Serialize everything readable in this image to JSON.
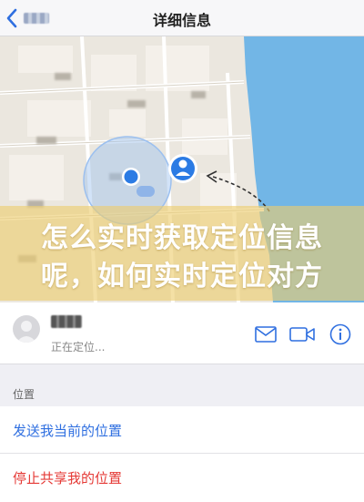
{
  "nav": {
    "title": "详细信息",
    "back_icon": "chevron-left-icon"
  },
  "overlay": {
    "line1": "怎么实时获取定位信息",
    "line2": "呢，如何实时定位对方"
  },
  "contact": {
    "status": "正在定位...",
    "actions": [
      "mail-icon",
      "video-call-icon",
      "info-icon"
    ]
  },
  "location_section": {
    "title": "位置",
    "send_label": "发送我当前的位置",
    "stop_label": "停止共享我的位置"
  },
  "colors": {
    "accent": "#2f6fe0",
    "destructive": "#e53935",
    "water": "#6fb4e6",
    "location_dot": "#2b7be4"
  }
}
